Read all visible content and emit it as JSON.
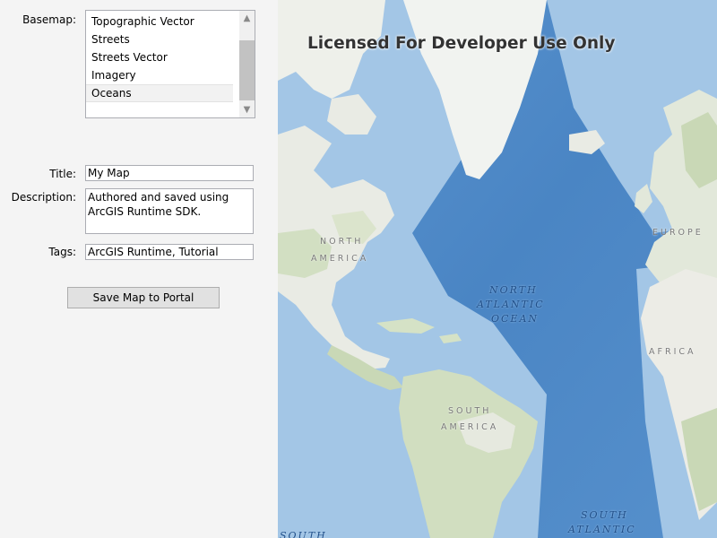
{
  "form": {
    "basemap_label": "Basemap:",
    "basemap_options": [
      "Topographic Vector",
      "Streets",
      "Streets Vector",
      "Imagery",
      "Oceans"
    ],
    "basemap_selected": "Oceans",
    "title_label": "Title:",
    "title_value": "My Map",
    "description_label": "Description:",
    "description_value": "Authored and saved using ArcGIS Runtime SDK.",
    "tags_label": "Tags:",
    "tags_value": "ArcGIS Runtime, Tutorial",
    "save_button_label": "Save Map to Portal"
  },
  "map": {
    "watermark": "Licensed For Developer Use Only",
    "labels": {
      "north_america_1": "NORTH",
      "north_america_2": "AMERICA",
      "europe": "EUROPE",
      "africa": "AFRICA",
      "south_america_1": "SOUTH",
      "south_america_2": "AMERICA",
      "north_atlantic_1": "NORTH",
      "north_atlantic_2": "ATLANTIC",
      "north_atlantic_3": "OCEAN",
      "south_atlantic_1": "SOUTH",
      "south_atlantic_2": "ATLANTIC",
      "south_pacific_partial": "SOUTH"
    },
    "colors": {
      "deep_ocean": "#4f8ac9",
      "shelf_ocean": "#a9cbe8",
      "land": "#e9ebe4",
      "vegetation": "#c9d8b6",
      "ice": "#f2f4f2"
    }
  }
}
